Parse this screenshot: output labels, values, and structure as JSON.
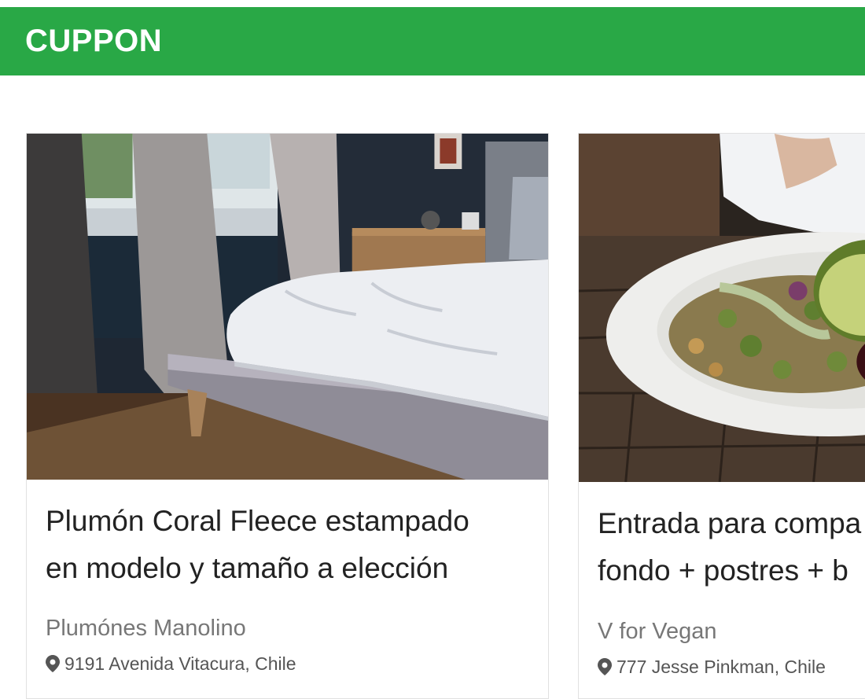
{
  "navbar": {
    "brand": "CUPPON"
  },
  "colors": {
    "brand_green": "#29a846"
  },
  "deals": [
    {
      "image_subject": "bedroom with bed and duvet",
      "title_line1": "Plumón Coral Fleece estampado",
      "title_line2": "en modelo y tamaño a elección",
      "merchant": "Plumónes Manolino",
      "location_icon": "map-pin-icon",
      "address": "9191 Avenida Vitacura, Chile"
    },
    {
      "image_subject": "vegan plate with avocado and quinoa",
      "title_line1": "Entrada para compa",
      "title_line2": "fondo + postres + b",
      "merchant": "V for Vegan",
      "location_icon": "map-pin-icon",
      "address": "777 Jesse Pinkman, Chile"
    }
  ]
}
